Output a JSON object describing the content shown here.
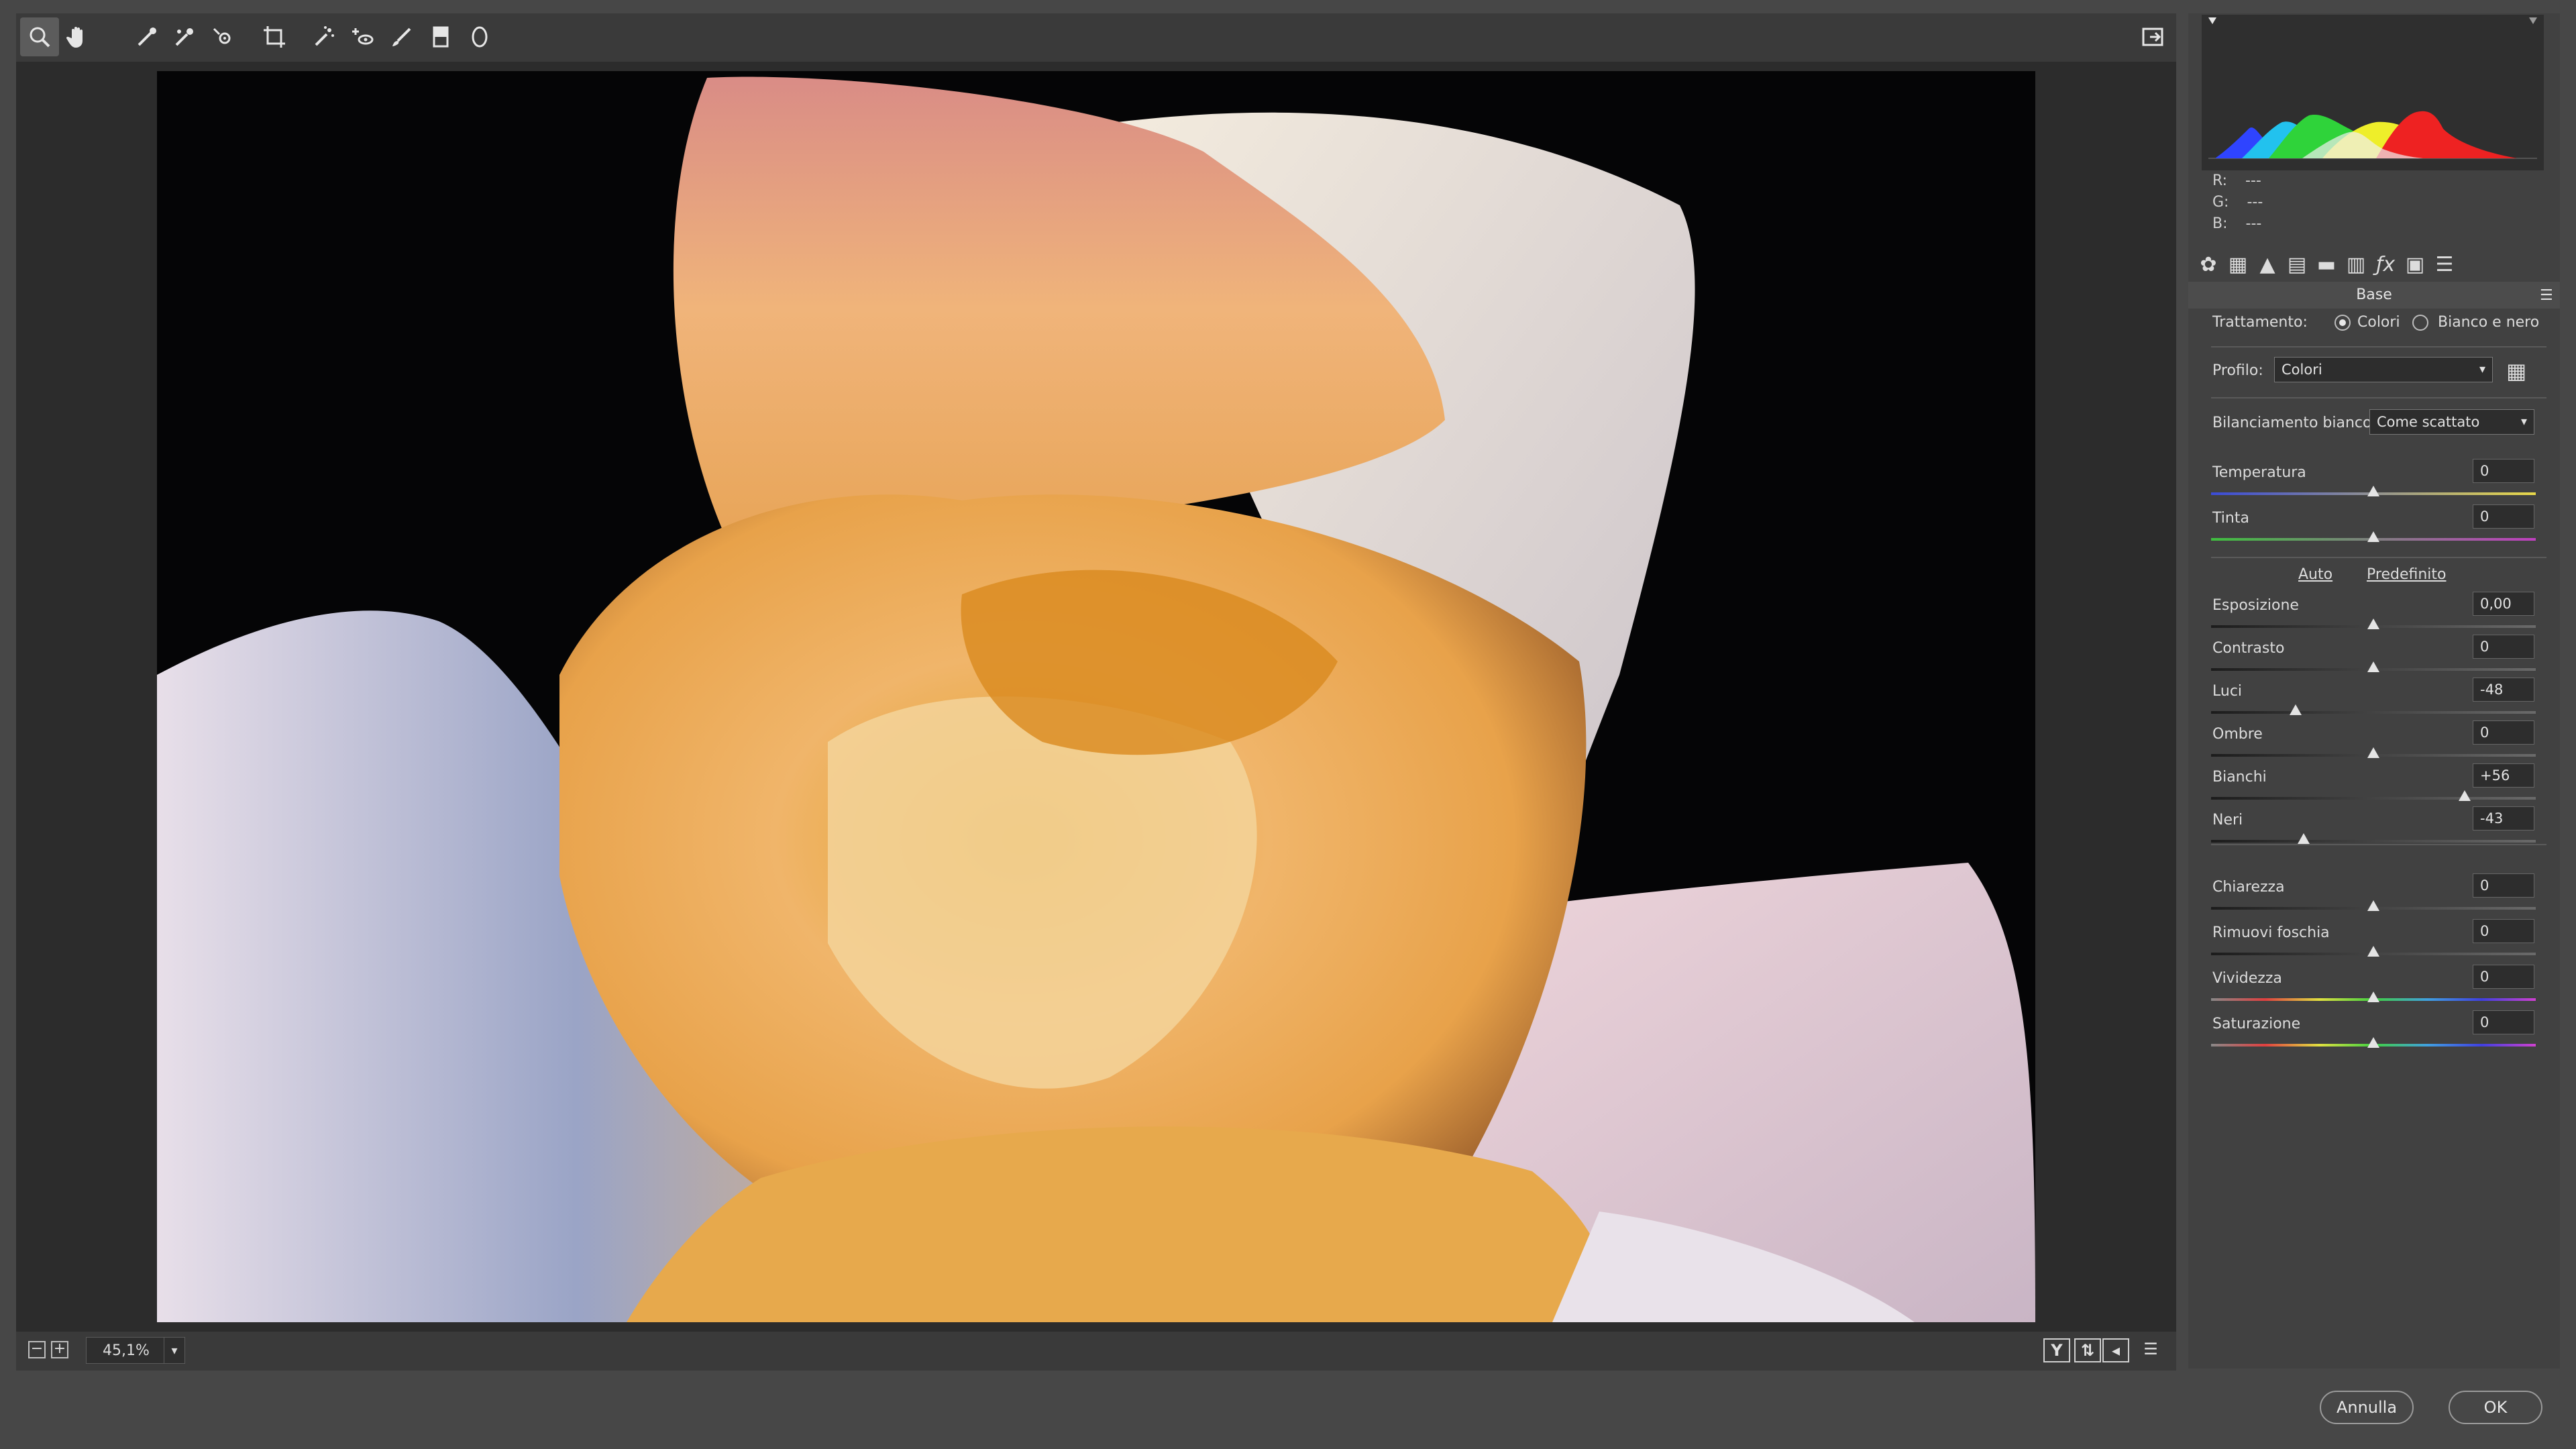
{
  "toolbar": {
    "tools": [
      {
        "name": "zoom-tool",
        "active": true
      },
      {
        "name": "hand-tool"
      },
      {
        "name": "white-balance-tool"
      },
      {
        "name": "color-sampler-tool"
      },
      {
        "name": "targeted-adjustment-tool"
      },
      {
        "name": "crop-tool"
      },
      {
        "name": "spot-removal-tool"
      },
      {
        "name": "red-eye-tool"
      },
      {
        "name": "adjustment-brush-tool"
      },
      {
        "name": "graduated-filter-tool"
      },
      {
        "name": "radial-filter-tool"
      }
    ]
  },
  "statusbar": {
    "zoom": "45,1%"
  },
  "histogram": {
    "r": "R:",
    "g": "G:",
    "b": "B:",
    "r_value": "---",
    "g_value": "---",
    "b_value": "---"
  },
  "panel": {
    "section_title": "Base",
    "treatment_label": "Trattamento:",
    "treatment_color": "Colori",
    "treatment_bw": "Bianco e nero",
    "profile_label": "Profilo:",
    "profile_value": "Colori",
    "wb_label": "Bilanciamento bianco:",
    "wb_value": "Come scattato",
    "auto_label": "Auto",
    "default_label": "Predefinito",
    "sliders": [
      {
        "label": "Temperatura",
        "value": "0",
        "level": 0
      },
      {
        "label": "Tinta",
        "value": "0",
        "level": 0
      },
      {
        "label": "Esposizione",
        "value": "0,00",
        "level": 0
      },
      {
        "label": "Contrasto",
        "value": "0",
        "level": 0
      },
      {
        "label": "Luci",
        "value": "-48",
        "level": -48
      },
      {
        "label": "Ombre",
        "value": "0",
        "level": 0
      },
      {
        "label": "Bianchi",
        "value": "+56",
        "level": 56
      },
      {
        "label": "Neri",
        "value": "-43",
        "level": -43
      },
      {
        "label": "Chiarezza",
        "value": "0",
        "level": 0
      },
      {
        "label": "Rimuovi foschia",
        "value": "0",
        "level": 0
      },
      {
        "label": "Vividezza",
        "value": "0",
        "level": 0
      },
      {
        "label": "Saturazione",
        "value": "0",
        "level": 0
      }
    ]
  },
  "buttons": {
    "cancel": "Annulla",
    "ok": "OK"
  },
  "colors": {
    "temp_gradient": [
      "#3a4bd8",
      "#e8d84a"
    ],
    "tint_gradient": [
      "#3fbf3f",
      "#c040c0"
    ]
  }
}
